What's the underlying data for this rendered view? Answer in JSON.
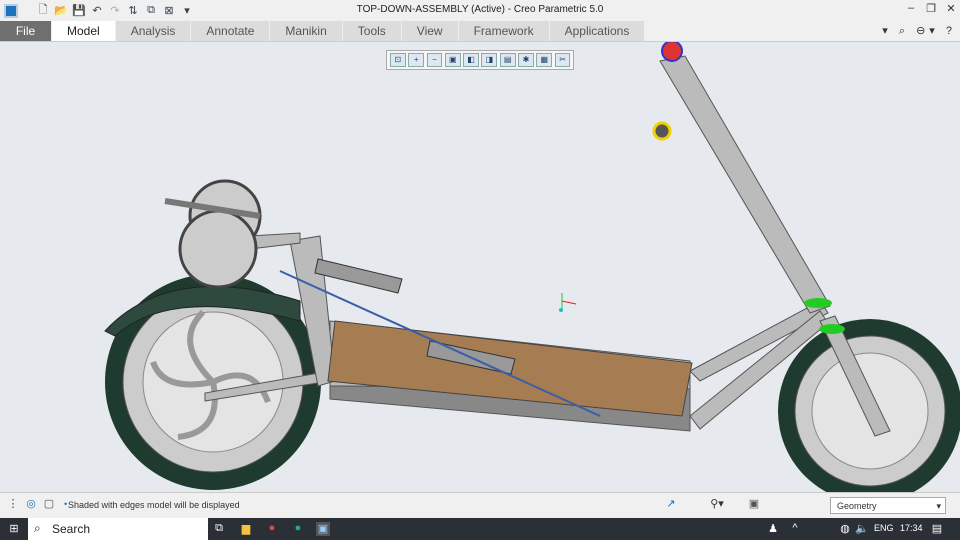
{
  "window": {
    "title": "TOP-DOWN-ASSEMBLY (Active) - Creo Parametric 5.0"
  },
  "ribbon": {
    "tabs": [
      {
        "label": "File"
      },
      {
        "label": "Model"
      },
      {
        "label": "Analysis"
      },
      {
        "label": "Annotate"
      },
      {
        "label": "Manikin"
      },
      {
        "label": "Tools"
      },
      {
        "label": "View"
      },
      {
        "label": "Framework"
      },
      {
        "label": "Applications"
      }
    ],
    "active": "Model"
  },
  "status": {
    "message": "Shaded with edges model will be displayed",
    "filter": "Geometry"
  },
  "taskbar": {
    "search": "Search",
    "lang": "ENG",
    "time": "17:34"
  },
  "colors": {
    "accent": "#1e73be",
    "deck": "#a67c52",
    "tire": "#1f3a2f"
  }
}
